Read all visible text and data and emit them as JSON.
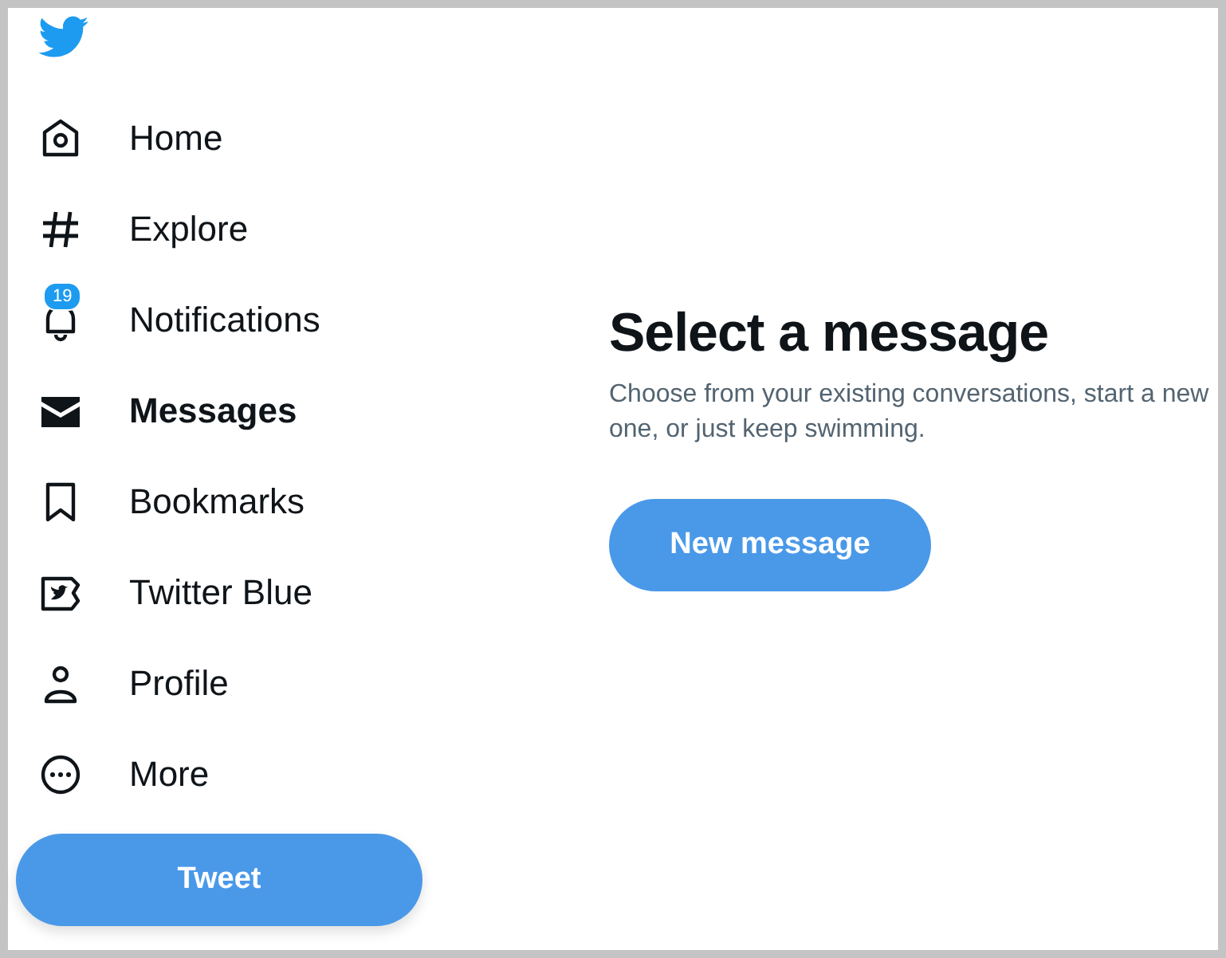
{
  "nav": [
    {
      "kind": "home",
      "label": "Home",
      "selected": false
    },
    {
      "kind": "explore",
      "label": "Explore",
      "selected": false
    },
    {
      "kind": "notifications",
      "label": "Notifications",
      "selected": false,
      "badge": "19"
    },
    {
      "kind": "messages",
      "label": "Messages",
      "selected": true
    },
    {
      "kind": "bookmarks",
      "label": "Bookmarks",
      "selected": false
    },
    {
      "kind": "blue",
      "label": "Twitter Blue",
      "selected": false
    },
    {
      "kind": "profile",
      "label": "Profile",
      "selected": false
    },
    {
      "kind": "more",
      "label": "More",
      "selected": false
    }
  ],
  "tweet_button": "Tweet",
  "main": {
    "title": "Select a message",
    "text": "Choose from your existing conversations, start a new one, or just keep swimming.",
    "button": "New message"
  }
}
